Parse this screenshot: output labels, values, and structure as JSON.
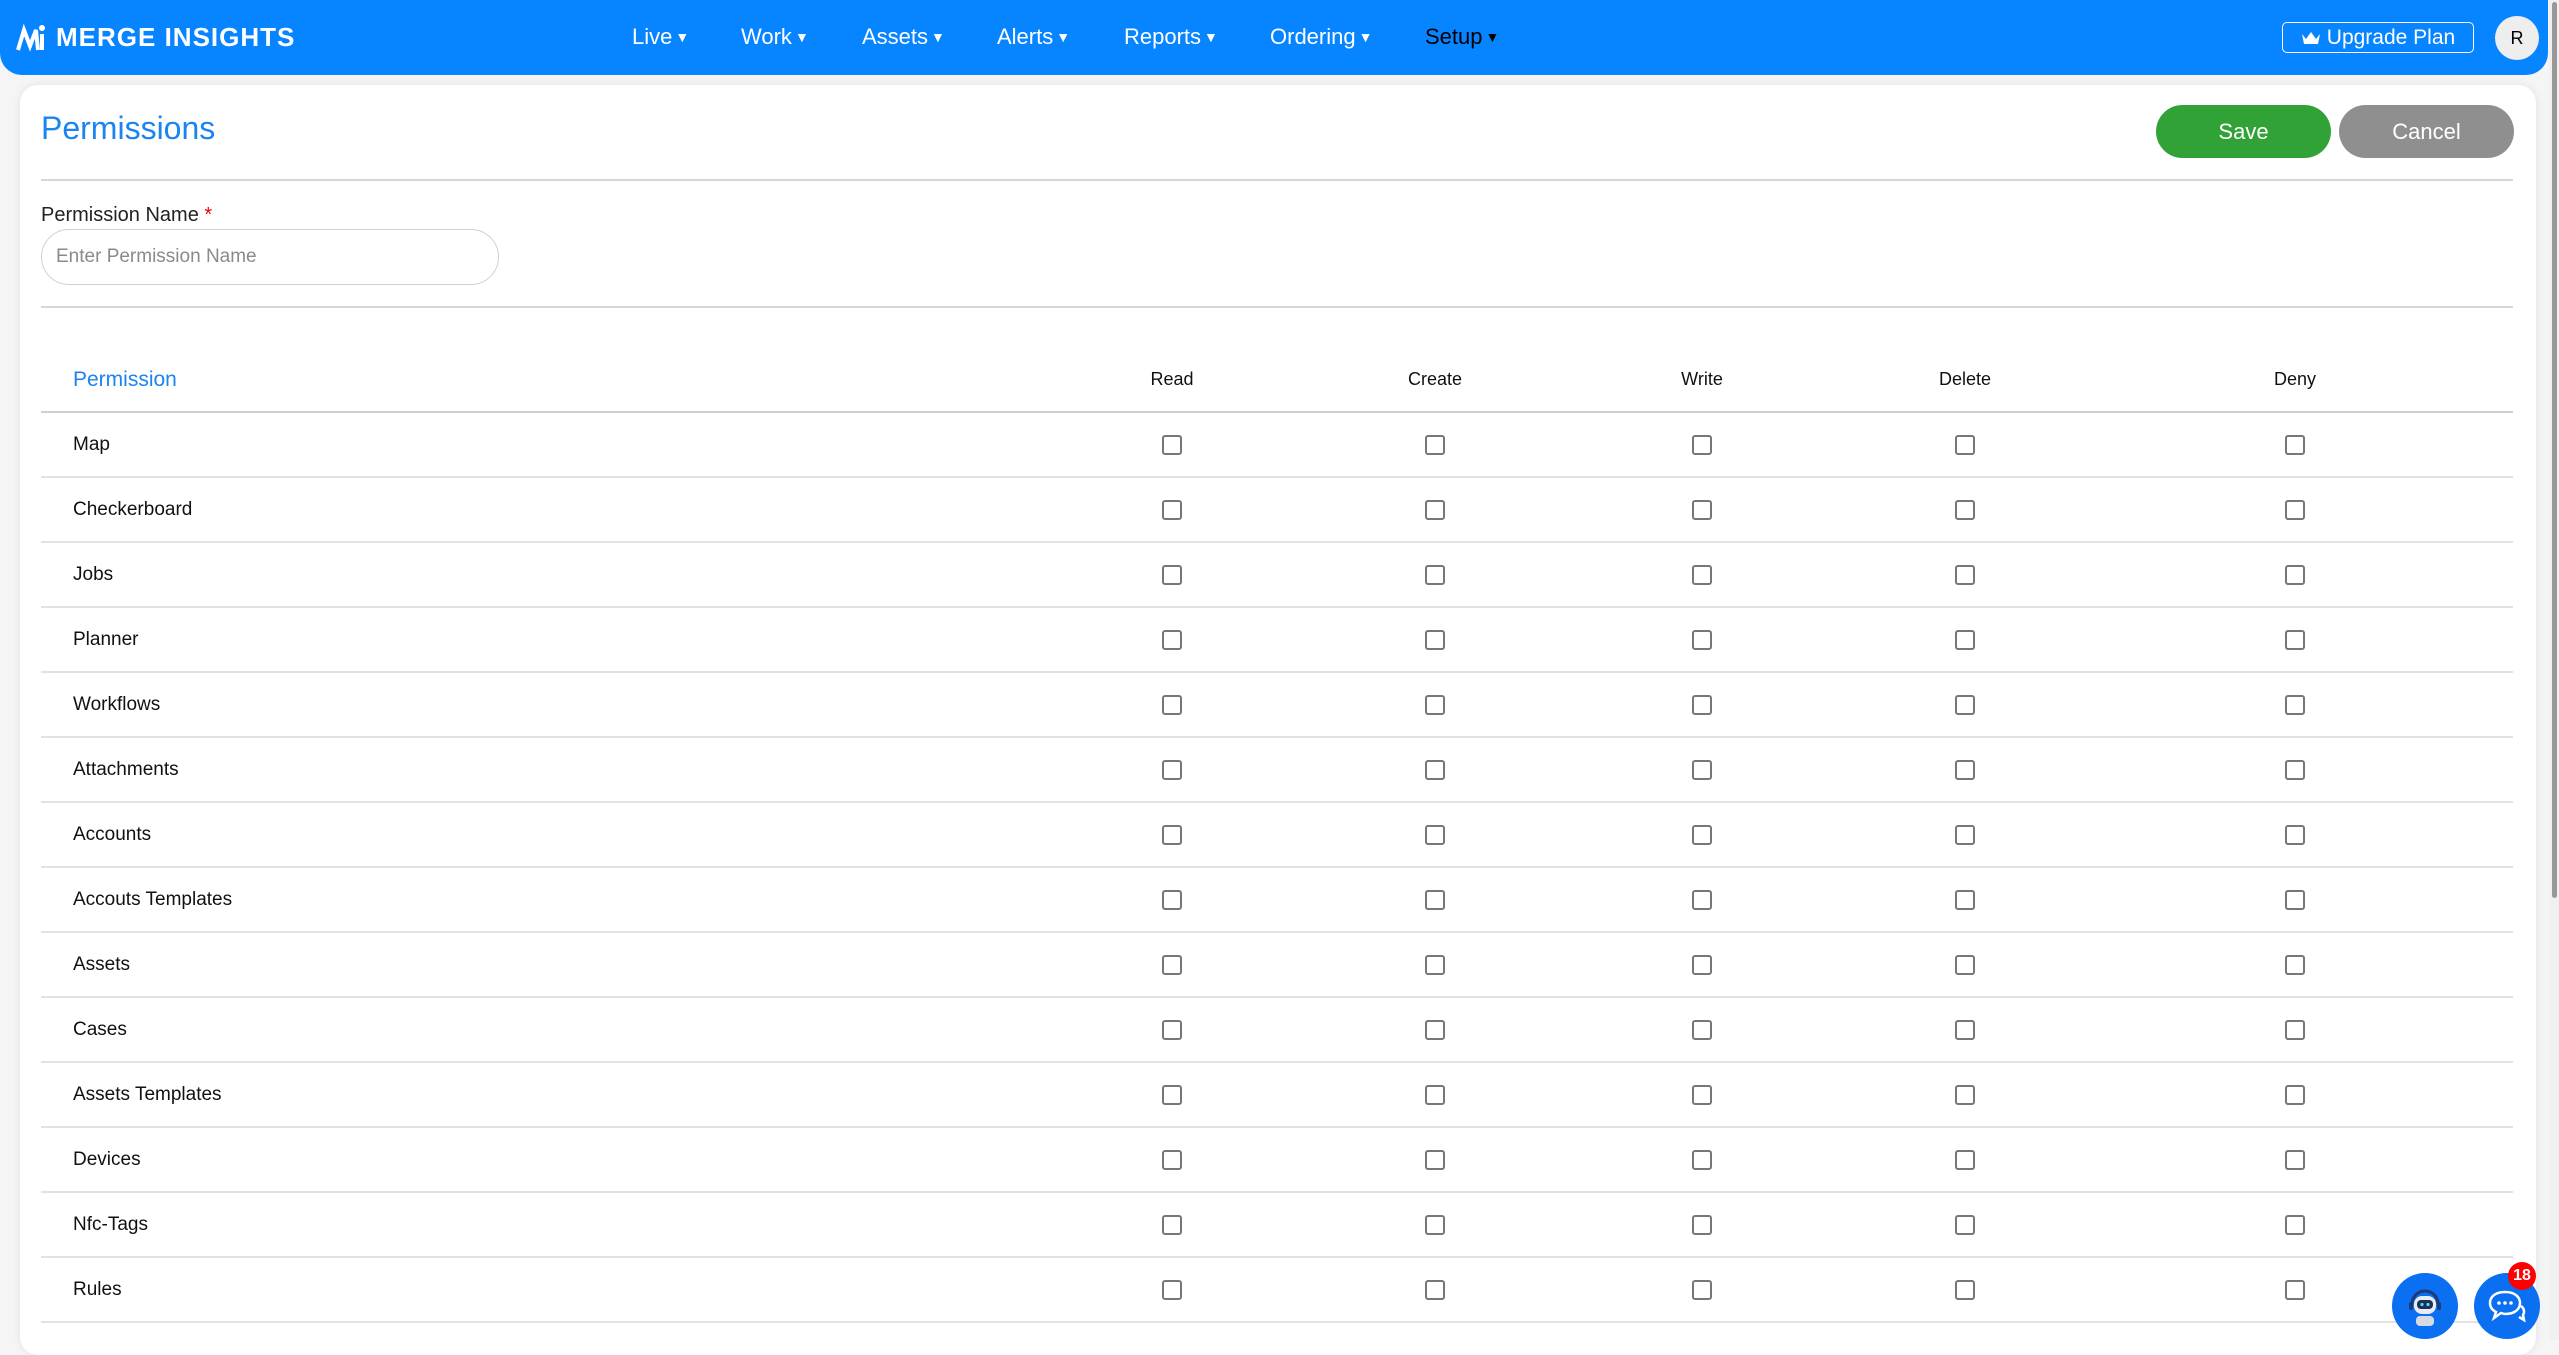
{
  "header": {
    "brand": "MERGE INSIGHTS",
    "nav": [
      {
        "label": "Live"
      },
      {
        "label": "Work"
      },
      {
        "label": "Assets"
      },
      {
        "label": "Alerts"
      },
      {
        "label": "Reports"
      },
      {
        "label": "Ordering"
      },
      {
        "label": "Setup",
        "active": true
      }
    ],
    "upgrade_label": "Upgrade Plan",
    "avatar_initial": "R",
    "accent": "#0784ff"
  },
  "page": {
    "title": "Permissions",
    "save_label": "Save",
    "cancel_label": "Cancel",
    "name_label": "Permission Name",
    "required_mark": "*",
    "name_placeholder": "Enter Permission Name",
    "name_value": ""
  },
  "table": {
    "columns": [
      "Permission",
      "Read",
      "Create",
      "Write",
      "Delete",
      "Deny"
    ],
    "rows": [
      {
        "name": "Map",
        "checks": [
          false,
          false,
          false,
          false,
          false
        ]
      },
      {
        "name": "Checkerboard",
        "checks": [
          false,
          false,
          false,
          false,
          false
        ]
      },
      {
        "name": "Jobs",
        "checks": [
          false,
          false,
          false,
          false,
          false
        ]
      },
      {
        "name": "Planner",
        "checks": [
          false,
          false,
          false,
          false,
          false
        ]
      },
      {
        "name": "Workflows",
        "checks": [
          false,
          false,
          false,
          false,
          false
        ]
      },
      {
        "name": "Attachments",
        "checks": [
          false,
          false,
          false,
          false,
          false
        ]
      },
      {
        "name": "Accounts",
        "checks": [
          false,
          false,
          false,
          false,
          false
        ]
      },
      {
        "name": "Accouts Templates",
        "checks": [
          false,
          false,
          false,
          false,
          false
        ]
      },
      {
        "name": "Assets",
        "checks": [
          false,
          false,
          false,
          false,
          false
        ]
      },
      {
        "name": "Cases",
        "checks": [
          false,
          false,
          false,
          false,
          false
        ]
      },
      {
        "name": "Assets Templates",
        "checks": [
          false,
          false,
          false,
          false,
          false
        ]
      },
      {
        "name": "Devices",
        "checks": [
          false,
          false,
          false,
          false,
          false
        ]
      },
      {
        "name": "Nfc-Tags",
        "checks": [
          false,
          false,
          false,
          false,
          false
        ]
      },
      {
        "name": "Rules",
        "checks": [
          false,
          false,
          false,
          false,
          false
        ]
      }
    ]
  },
  "chat": {
    "unread_count": "18"
  }
}
